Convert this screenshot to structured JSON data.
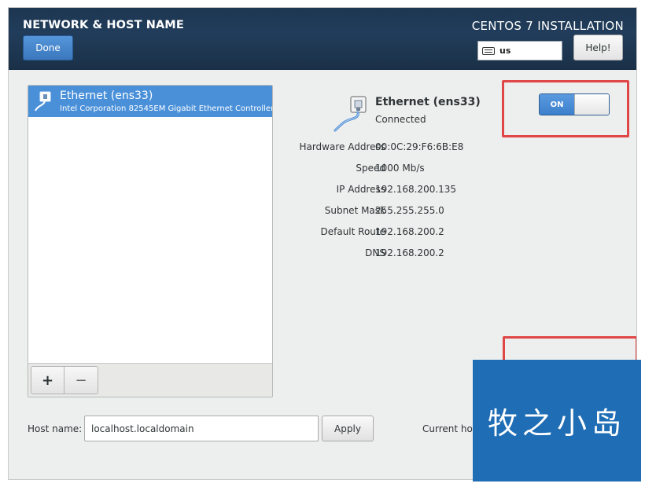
{
  "header": {
    "title": "NETWORK & HOST NAME",
    "done_label": "Done",
    "product": "CENTOS 7 INSTALLATION",
    "keyboard_layout": "us",
    "help_label": "Help!"
  },
  "device_list": {
    "items": [
      {
        "name": "Ethernet (ens33)",
        "description": "Intel Corporation 82545EM Gigabit Ethernet Controller (",
        "selected": true
      }
    ],
    "add_label": "+",
    "remove_label": "−"
  },
  "details": {
    "name": "Ethernet (ens33)",
    "status": "Connected",
    "rows": [
      {
        "label": "Hardware Address",
        "value": "00:0C:29:F6:6B:E8"
      },
      {
        "label": "Speed",
        "value": "1000 Mb/s"
      },
      {
        "label": "IP Address",
        "value": "192.168.200.135"
      },
      {
        "label": "Subnet Mask",
        "value": "255.255.255.0"
      },
      {
        "label": "Default Route",
        "value": "192.168.200.2"
      },
      {
        "label": "DNS",
        "value": "192.168.200.2"
      }
    ],
    "switch": {
      "on_label": "ON",
      "state": "on"
    }
  },
  "hostname": {
    "label": "Host name:",
    "value": "localhost.localdomain",
    "apply_label": "Apply",
    "current_label": "Current hos"
  },
  "watermark": "牧之小岛",
  "colors": {
    "header_bg": "#213d5b",
    "accent": "#4a90d9",
    "highlight_box": "#e04646",
    "watermark_bg": "#1f6db4"
  }
}
